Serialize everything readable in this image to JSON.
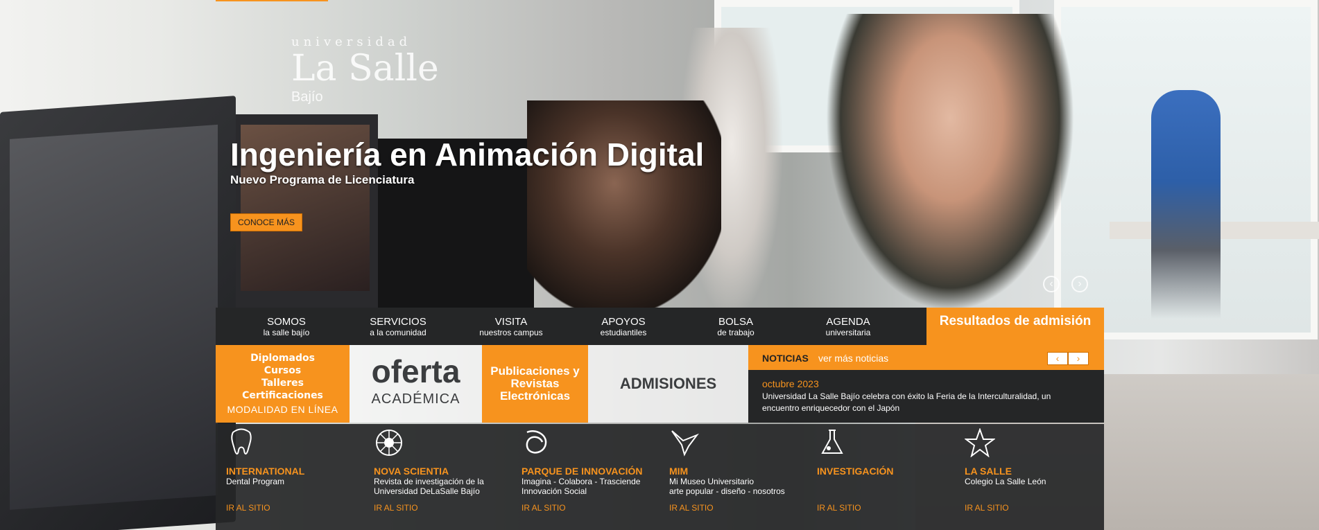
{
  "brand": {
    "line1": "universidad",
    "line2": "La Salle",
    "line3": "Bajío",
    "accent": "#f7931e",
    "dark": "#252627"
  },
  "slide": {
    "title": "Ingeniería en Animación Digital",
    "subtitle": "Nuevo Programa de Licenciatura",
    "cta": "CONOCE MÁS",
    "prev_icon": "chevron-left-icon",
    "next_icon": "chevron-right-icon"
  },
  "nav": {
    "items": [
      {
        "title": "SOMOS",
        "sub": "la salle bajío"
      },
      {
        "title": "SERVICIOS",
        "sub": "a la comunidad"
      },
      {
        "title": "VISITA",
        "sub": "nuestros campus"
      },
      {
        "title": "APOYOS",
        "sub": "estudiantiles"
      },
      {
        "title": "BOLSA",
        "sub": "de trabajo"
      },
      {
        "title": "AGENDA",
        "sub": "universitaria"
      }
    ],
    "highlight": "Resultados de admisión"
  },
  "features": {
    "diplomados": [
      "Diplomados",
      "Cursos",
      "Talleres",
      "Certificaciones"
    ],
    "modalidad": "MODALIDAD EN LÍNEA",
    "oferta_big": "oferta",
    "oferta_small": "ACADÉMICA",
    "publicaciones": "Publicaciones y Revistas Electrónicas",
    "admisiones": "ADMISIONES"
  },
  "news": {
    "label": "NOTICIAS",
    "more": "ver más noticias",
    "prev": "‹",
    "next": "›",
    "date": "octubre 2023",
    "text": "Universidad La Salle Bajío celebra con éxito la Feria de la Interculturalidad, un encuentro enriquecedor con el Japón"
  },
  "sites": [
    {
      "icon": "tooth-icon",
      "title": "INTERNATIONAL",
      "d1": "Dental Program",
      "d2": "",
      "link": "IR AL SITIO"
    },
    {
      "icon": "atom-burst-icon",
      "title": "NOVA SCIENTIA",
      "d1": "Revista de investigación de la",
      "d2": "Universidad DeLaSalle Bajío",
      "link": "IR AL SITIO"
    },
    {
      "icon": "loop-icon",
      "title": "PARQUE DE INNOVACIÓN",
      "d1": "Imagina - Colabora - Trasciende",
      "d2": "Innovación Social",
      "link": "IR AL SITIO"
    },
    {
      "icon": "bird-icon",
      "title": "MIM",
      "d1": "Mi Museo Universitario",
      "d2": "arte popular - diseño - nosotros",
      "link": "IR AL SITIO"
    },
    {
      "icon": "flask-icon",
      "title": "INVESTIGACIÓN",
      "d1": "",
      "d2": "",
      "link": "IR AL SITIO"
    },
    {
      "icon": "star-icon",
      "title": "LA SALLE",
      "d1": "Colegio La Salle León",
      "d2": "",
      "link": "IR AL SITIO"
    }
  ]
}
